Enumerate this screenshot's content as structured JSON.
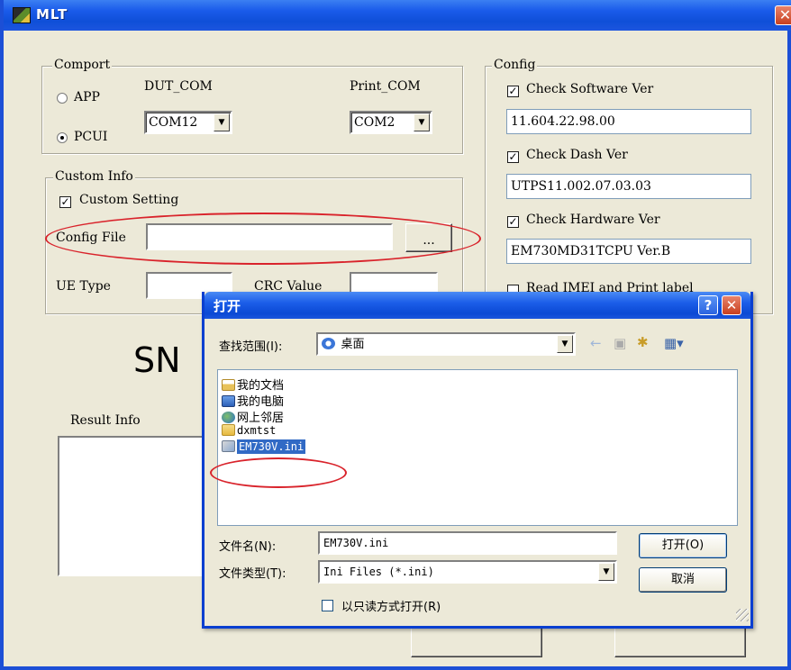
{
  "window": {
    "title": "MLT",
    "close_glyph": "✕"
  },
  "comport": {
    "legend": "Comport",
    "radio_app": "APP",
    "radio_pcui": "PCUI",
    "selected_mode": "PCUI",
    "dut_com_label": "DUT_COM",
    "dut_com_value": "COM12",
    "print_com_label": "Print_COM",
    "print_com_value": "COM2"
  },
  "custom_info": {
    "legend": "Custom Info",
    "custom_setting_label": "Custom Setting",
    "custom_setting_checked": true,
    "config_file_label": "Config File",
    "config_file_value": "",
    "browse_label": "...",
    "ue_type_label": "UE Type",
    "crc_value_label": "CRC Value"
  },
  "config": {
    "legend": "Config",
    "check_software_label": "Check Software Ver",
    "software_ver": "11.604.22.98.00",
    "check_dash_label": "Check Dash Ver",
    "dash_ver": "UTPS11.002.07.03.03",
    "check_hardware_label": "Check  Hardware Ver",
    "hardware_ver": "EM730MD31TCPU Ver.B",
    "read_imei_label": "Read  IMEI and Print label"
  },
  "sn_label": "SN",
  "result_info_label": "Result Info",
  "open_dialog": {
    "title": "打开",
    "look_in_label": "查找范围(I):",
    "look_in_value": "桌面",
    "files": [
      {
        "name": "我的文档",
        "icon": "my-documents-icon"
      },
      {
        "name": "我的电脑",
        "icon": "my-computer-icon"
      },
      {
        "name": "网上邻居",
        "icon": "network-places-icon"
      },
      {
        "name": "dxmtst",
        "icon": "folder-icon"
      },
      {
        "name": "EM730V.ini",
        "icon": "ini-file-icon",
        "selected": true
      }
    ],
    "file_name_label": "文件名(N):",
    "file_name_value": "EM730V.ini",
    "file_type_label": "文件类型(T):",
    "file_type_value": "Ini Files (*.ini)",
    "readonly_label": "以只读方式打开(R)",
    "open_button": "打开(O)",
    "cancel_button": "取消",
    "help_glyph": "?",
    "close_glyph": "✕"
  },
  "colors": {
    "titlebar_blue": "#0f4fd8",
    "window_face": "#ece9d8",
    "annotation_red": "#d9232b",
    "selection_blue": "#316ac5"
  }
}
